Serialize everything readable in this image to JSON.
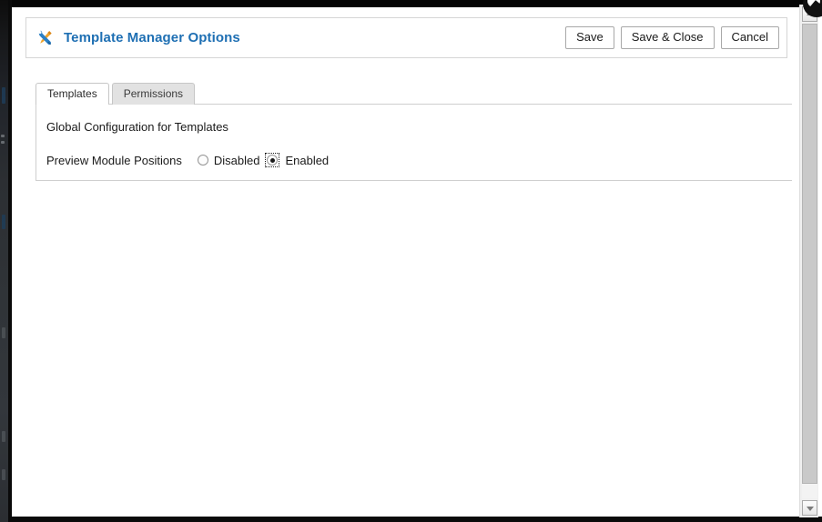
{
  "header": {
    "icon": "tools-wrench-screwdriver-icon",
    "title": "Template Manager Options",
    "title_color": "#1e6fb3",
    "buttons": [
      {
        "label": "Save",
        "name": "save-button"
      },
      {
        "label": "Save & Close",
        "name": "save-and-close-button"
      },
      {
        "label": "Cancel",
        "name": "cancel-button"
      }
    ]
  },
  "tabs": [
    {
      "label": "Templates",
      "active": true
    },
    {
      "label": "Permissions",
      "active": false
    }
  ],
  "content": {
    "section_label": "Global Configuration for Templates",
    "field": {
      "label": "Preview Module Positions",
      "options": [
        {
          "label": "Disabled",
          "selected": false,
          "focused": false
        },
        {
          "label": "Enabled",
          "selected": true,
          "focused": true
        }
      ]
    }
  },
  "scrollbar": {
    "up_arrow": "scroll-up-arrow-icon",
    "down_arrow": "scroll-down-arrow-icon",
    "orientation": "vertical"
  }
}
